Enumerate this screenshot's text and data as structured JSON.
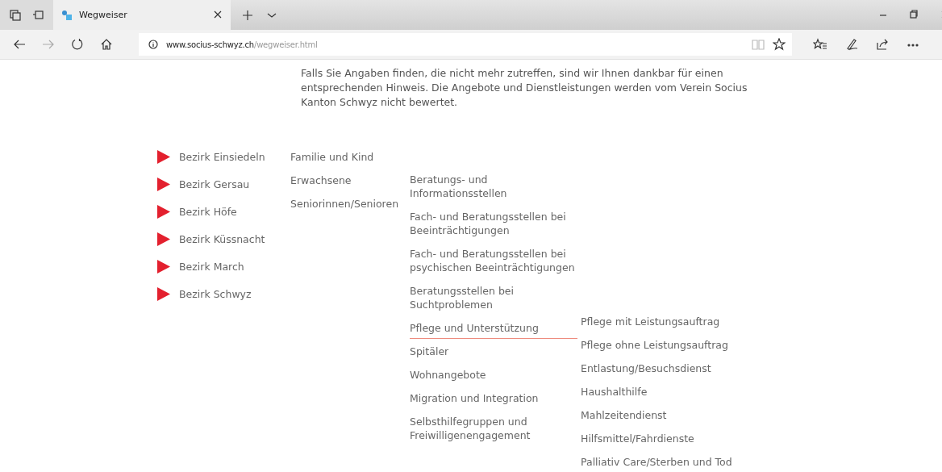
{
  "browser": {
    "tab_title": "Wegweiser",
    "url_host": "www.socius-schwyz.ch",
    "url_path": "/wegweiser.html"
  },
  "intro": "Falls Sie Angaben finden, die nicht mehr zutreffen, sind wir Ihnen dankbar für einen entsprechenden Hinweis. Die Angebote und Dienstleistungen werden vom Verein Socius Kanton Schwyz nicht bewertet.",
  "districts": [
    "Bezirk Einsiedeln",
    "Bezirk Gersau",
    "Bezirk Höfe",
    "Bezirk Küssnacht",
    "Bezirk March",
    "Bezirk Schwyz"
  ],
  "groups": [
    "Familie und Kind",
    "Erwachsene",
    "Seniorinnen/Senioren"
  ],
  "topics": [
    {
      "label": "Beratungs- und Informationsstellen",
      "selected": false
    },
    {
      "label": "Fach- und Beratungsstellen bei Beeinträchtigungen",
      "selected": false
    },
    {
      "label": "Fach- und Beratungsstellen bei psychischen Beeinträchtigungen",
      "selected": false
    },
    {
      "label": "Beratungsstellen bei Suchtproblemen",
      "selected": false
    },
    {
      "label": "Pflege und Unterstützung",
      "selected": true
    },
    {
      "label": "Spitäler",
      "selected": false
    },
    {
      "label": "Wohnangebote",
      "selected": false
    },
    {
      "label": "Migration und Integration",
      "selected": false
    },
    {
      "label": "Selbsthilfegruppen und Freiwilligenengagement",
      "selected": false
    }
  ],
  "subtopics": [
    "Pflege mit Leistungsauftrag",
    "Pflege ohne Leistungsauftrag",
    "Entlastung/Besuchsdienst",
    "Haushalthilfe",
    "Mahlzeitendienst",
    "Hilfsmittel/Fahrdienste",
    "Palliativ Care/Sterben und Tod"
  ]
}
